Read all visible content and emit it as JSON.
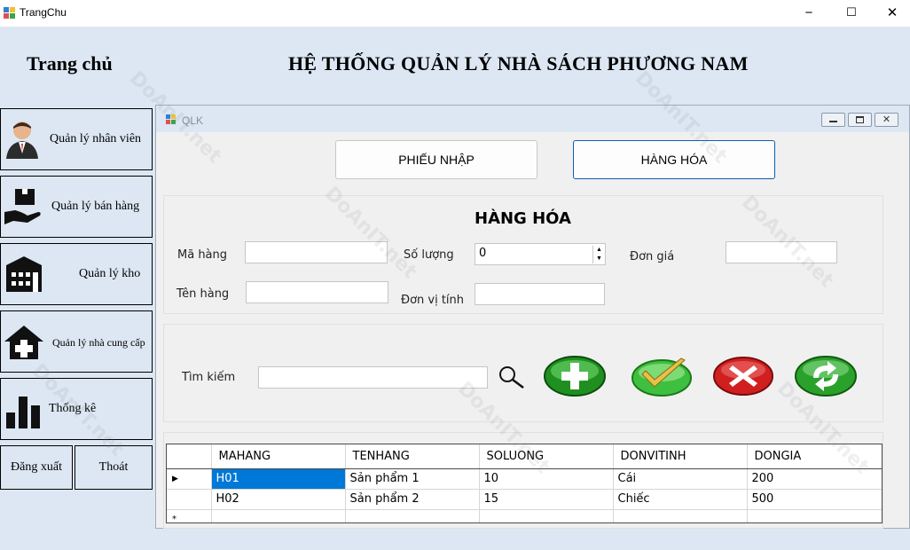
{
  "window": {
    "title": "TrangChu",
    "minimize": "−",
    "maximize": "☐",
    "close": "✕"
  },
  "header": {
    "home_title": "Trang chủ",
    "system_title": "HỆ THỐNG QUẢN LÝ NHÀ SÁCH PHƯƠNG NAM"
  },
  "menu": {
    "items": [
      {
        "label": "Quản lý nhân viên",
        "icon": "user-icon"
      },
      {
        "label": "Quản lý bán hàng",
        "icon": "box-hand-icon"
      },
      {
        "label": "Quản lý kho",
        "icon": "warehouse-icon"
      },
      {
        "label": "Quản lý nhà cung cấp",
        "icon": "house-add-icon"
      },
      {
        "label": "Thống kê",
        "icon": "bar-chart-icon"
      }
    ],
    "logout": "Đăng xuất",
    "exit": "Thoát"
  },
  "child": {
    "title": "QLK",
    "tabs": [
      "PHIẾU NHẬP",
      "HÀNG HÓA"
    ],
    "section_title": "HÀNG HÓA",
    "form": {
      "ma_hang_label": "Mã hàng",
      "ten_hang_label": "Tên hàng",
      "so_luong_label": "Số lượng",
      "so_luong_value": "0",
      "don_vi_label": "Đơn vị tính",
      "don_gia_label": "Đơn giá"
    },
    "search_label": "Tìm kiếm",
    "grid": {
      "columns": [
        "MAHANG",
        "TENHANG",
        "SOLUONG",
        "DONVITINH",
        "DONGIA"
      ],
      "rows": [
        [
          "H01",
          "Sản phẩm 1",
          "10",
          "Cái",
          "200"
        ],
        [
          "H02",
          "Sản phẩm 2",
          "15",
          "Chiếc",
          "500"
        ]
      ],
      "new_row_marker": "*",
      "current_row_marker": "▶"
    }
  },
  "watermark": "DoAnIT.net"
}
